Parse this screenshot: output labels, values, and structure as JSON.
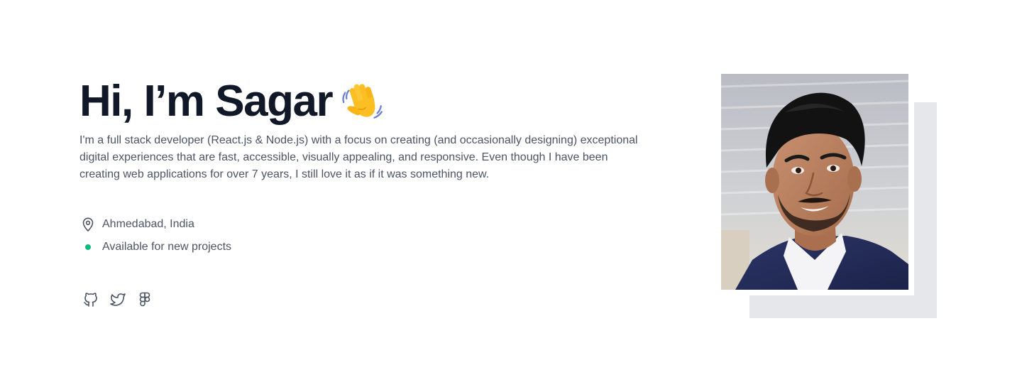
{
  "hero": {
    "title": "Hi, I’m Sagar",
    "emoji_icon": "waving-hand-icon",
    "intro": "I'm a full stack developer (React.js & Node.js) with a focus on creating (and occasionally designing) exceptional digital experiences that are fast, accessible, visually appealing, and responsive. Even though I have been creating web applications for over 7 years, I still love it as if it was something new.",
    "location": {
      "icon": "map-pin-icon",
      "text": "Ahmedabad, India"
    },
    "availability": {
      "icon": "status-dot",
      "text": "Available for new projects",
      "color": "#10b981"
    },
    "socials": [
      {
        "icon": "github-icon"
      },
      {
        "icon": "twitter-icon"
      },
      {
        "icon": "figma-icon"
      }
    ],
    "photo": {
      "backdrop_color": "#e5e7eb"
    }
  },
  "colors": {
    "heading": "#111827",
    "body": "#4b5563",
    "icon": "#4b5563"
  }
}
